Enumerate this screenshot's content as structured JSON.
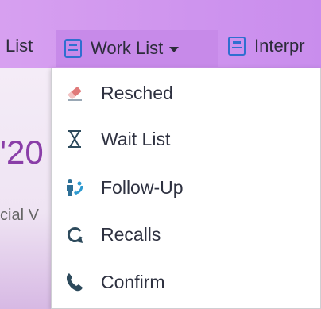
{
  "navbar": {
    "items": [
      {
        "label": "List"
      },
      {
        "label": "Work List"
      },
      {
        "label": "Interpr"
      }
    ]
  },
  "background": {
    "year_fragment": "'20",
    "subtext_fragment": "cial V"
  },
  "dropdown": {
    "items": [
      {
        "label": "Resched",
        "icon": "eraser-icon"
      },
      {
        "label": "Wait List",
        "icon": "hourglass-icon"
      },
      {
        "label": "Follow-Up",
        "icon": "people-return-icon"
      },
      {
        "label": "Recalls",
        "icon": "refresh-icon"
      },
      {
        "label": "Confirm",
        "icon": "phone-icon"
      }
    ]
  },
  "colors": {
    "navbar": "#cf95ee",
    "active_tab": "#c78ae9",
    "icon_blue": "#2f6f95",
    "accent_purple": "#8a3ea8"
  }
}
